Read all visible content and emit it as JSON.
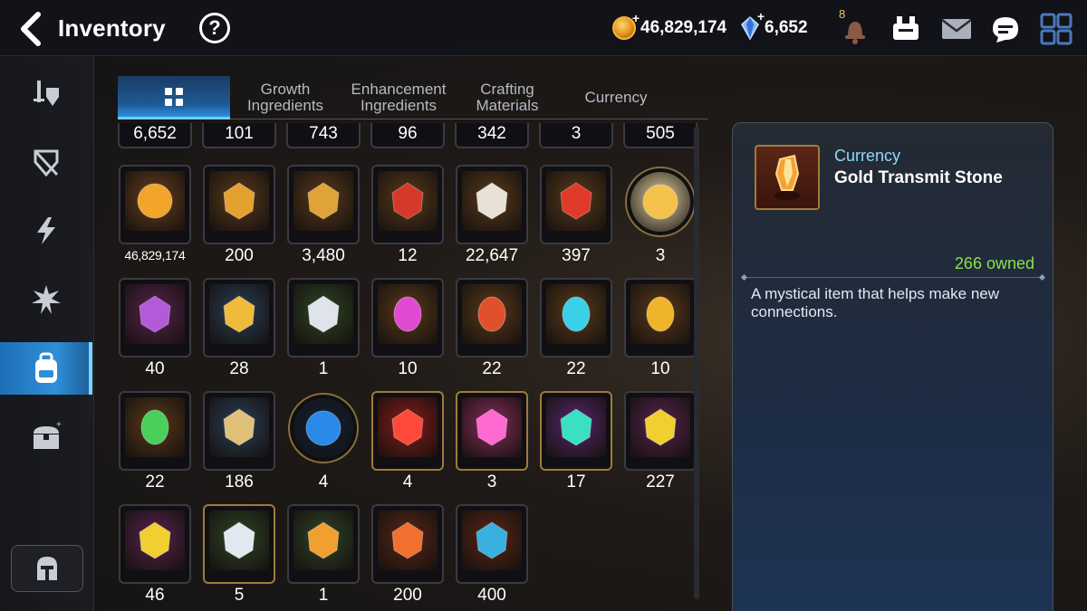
{
  "header": {
    "title": "Inventory",
    "help_label": "?",
    "gold": "46,829,174",
    "crystals": "6,652",
    "notification_count": "8"
  },
  "sidebar": {
    "items": [
      {
        "icon": "sword-shield-icon"
      },
      {
        "icon": "broken-shield-icon"
      },
      {
        "icon": "lightning-icon"
      },
      {
        "icon": "burst-sword-icon"
      },
      {
        "icon": "backpack-icon",
        "active": true
      },
      {
        "icon": "treasure-chest-icon"
      }
    ],
    "bottom_icon": "knight-helmet-icon"
  },
  "tabs": [
    {
      "label": "",
      "icon": "grid-icon",
      "active": true
    },
    {
      "label": "Growth Ingredients"
    },
    {
      "label": "Enhancement Ingredients"
    },
    {
      "label": "Crafting Materials"
    },
    {
      "label": "Currency"
    }
  ],
  "items": {
    "partial_row": [
      "6,652",
      "101",
      "743",
      "96",
      "342",
      "3",
      "505"
    ],
    "rows": [
      [
        {
          "count": "46,829,174",
          "icon": "gold-coin-icon",
          "bg": "#6b3f1c"
        },
        {
          "count": "200",
          "icon": "gold-emblem-icon",
          "bg": "#5b3a1a"
        },
        {
          "count": "3,480",
          "icon": "fist-emblem-icon",
          "bg": "#5b3a1a"
        },
        {
          "count": "12",
          "icon": "banner-flag-icon",
          "bg": "#5b3a1a"
        },
        {
          "count": "22,647",
          "icon": "horse-knight-icon",
          "bg": "#5b3a1a"
        },
        {
          "count": "397",
          "icon": "red-leaf-icon",
          "bg": "#5b3a1a"
        },
        {
          "count": "3",
          "icon": "phantasma-character-icon",
          "bg": "#e9d6a6",
          "shape": "round"
        }
      ],
      [
        {
          "count": "40",
          "icon": "purple-flower-icon",
          "bg": "#5a2350"
        },
        {
          "count": "28",
          "icon": "gold-flower-icon",
          "bg": "#2a3f57"
        },
        {
          "count": "1",
          "icon": "silver-flower-icon",
          "bg": "#2f4526"
        },
        {
          "count": "10",
          "icon": "magenta-rune-icon",
          "bg": "#5b3a1a"
        },
        {
          "count": "22",
          "icon": "red-rune-icon",
          "bg": "#5b3a1a"
        },
        {
          "count": "22",
          "icon": "cyan-rune-icon",
          "bg": "#5b3a1a"
        },
        {
          "count": "10",
          "icon": "yellow-rune-icon",
          "bg": "#5b3a1a"
        }
      ],
      [
        {
          "count": "22",
          "icon": "green-rune-icon",
          "bg": "#5b3a1a"
        },
        {
          "count": "186",
          "icon": "ginseng-root-icon",
          "bg": "#2a3f57"
        },
        {
          "count": "4",
          "icon": "blue-glyph-orb-icon",
          "bg": "#10213a",
          "shape": "round"
        },
        {
          "count": "4",
          "icon": "red-crystal-icon",
          "bg": "#8a1c1c",
          "shape": "hex"
        },
        {
          "count": "3",
          "icon": "pink-potion-icon",
          "bg": "#8a2d5c",
          "shape": "hex"
        },
        {
          "count": "17",
          "icon": "teal-transmit-stone-icon",
          "bg": "#5a2670",
          "shape": "hex"
        },
        {
          "count": "227",
          "icon": "yellow-transmit-stone-icon",
          "bg": "#5a2350"
        }
      ],
      [
        {
          "count": "46",
          "icon": "lightning-transmit-stone-icon",
          "bg": "#5a2350"
        },
        {
          "count": "5",
          "icon": "star-transmit-stone-icon",
          "bg": "#2f4526",
          "shape": "hex"
        },
        {
          "count": "1",
          "icon": "orange-transmit-stone-icon",
          "bg": "#2f4526"
        },
        {
          "count": "200",
          "icon": "gold-transmit-stone-icon",
          "bg": "#5b2617"
        },
        {
          "count": "400",
          "icon": "blue-shard-icon",
          "bg": "#5b2617"
        }
      ]
    ]
  },
  "detail": {
    "category": "Currency",
    "name": "Gold Transmit Stone",
    "owned": "266 owned",
    "description": "A mystical item that helps make new connections.",
    "icon": "gold-transmit-stone-icon"
  },
  "colors": {
    "accent_blue": "#2f8fd8",
    "owned_green": "#8be14a",
    "category_blue": "#8ed8ff"
  }
}
